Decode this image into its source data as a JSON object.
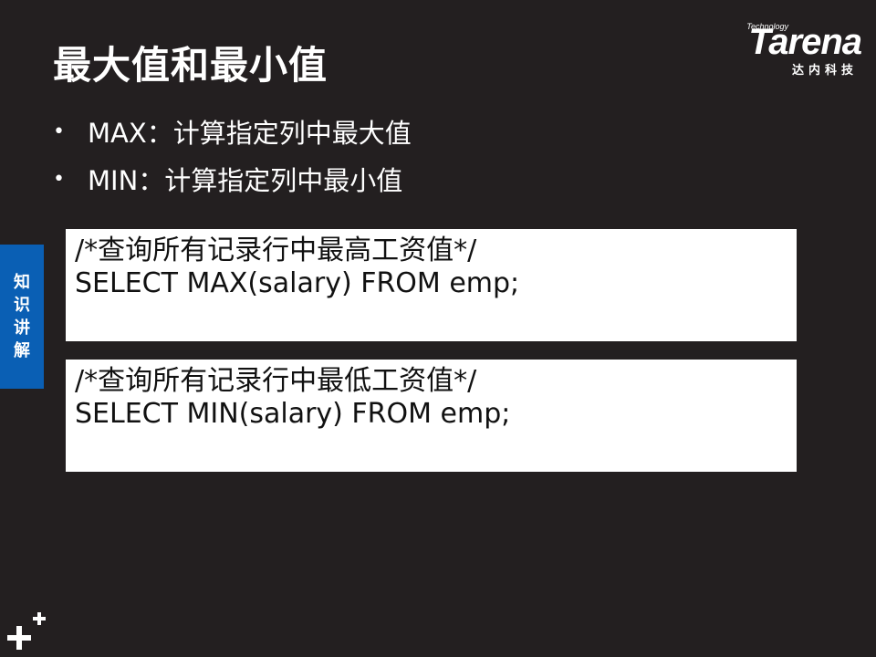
{
  "slide": {
    "title": "最大值和最小值",
    "bullets": [
      "MAX：计算指定列中最大值",
      "MIN：计算指定列中最小值"
    ]
  },
  "logo": {
    "technology": "Technology",
    "wordmark": "Tarena",
    "subtitle": "达内科技"
  },
  "side_tab": {
    "chars": [
      "知",
      "识",
      "讲",
      "解"
    ]
  },
  "code_blocks": [
    {
      "lines": [
        "/*查询所有记录行中最高工资值*/",
        "SELECT MAX(salary) FROM emp;"
      ]
    },
    {
      "lines": [
        "/*查询所有记录行中最低工资值*/",
        "SELECT MIN(salary) FROM emp;"
      ]
    }
  ],
  "icons": {
    "bullet": "bullet-dot-icon",
    "plus": "plus-logo-icon"
  },
  "colors": {
    "background": "#231f20",
    "side_tab": "#0a5fb4",
    "code_bg": "#ffffff"
  }
}
